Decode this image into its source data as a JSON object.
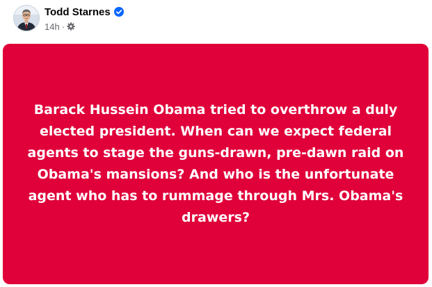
{
  "post": {
    "author": {
      "name": "Todd Starnes",
      "verified": true,
      "verified_color": "#0866ff",
      "avatar_icon": "profile-photo"
    },
    "timestamp": "14h",
    "separator": "·",
    "audience_icon": "gear-icon",
    "card": {
      "background_color": "#e0003a",
      "text_color": "#ffffff",
      "text": "Barack Hussein Obama tried to overthrow a duly elected president. When can we expect federal agents to stage the guns-drawn, pre-dawn raid on Obama's mansions? And who is the unfortunate agent who has to rummage through Mrs. Obama's drawers?"
    }
  }
}
